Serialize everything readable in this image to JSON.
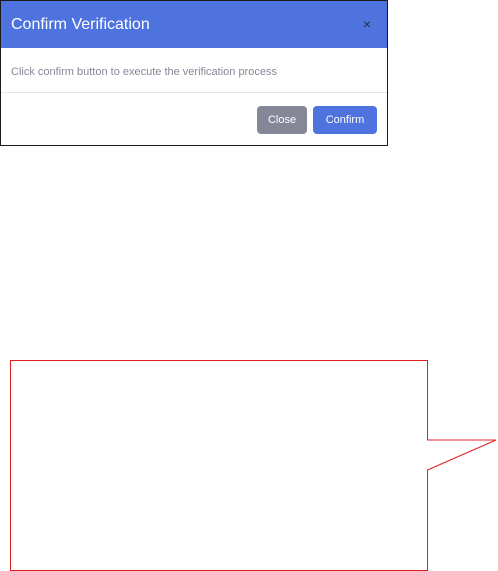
{
  "modal": {
    "title": "Confirm Verification",
    "close_icon": "×",
    "body_text": "Click confirm button to execute the verification process",
    "buttons": {
      "close_label": "Close",
      "confirm_label": "Confirm"
    }
  },
  "colors": {
    "header_bg": "#4e73df",
    "confirm_bg": "#4e73df",
    "close_bg": "#858796",
    "callout_stroke": "#e02020"
  },
  "icons": {
    "modal_close": "close-icon"
  }
}
